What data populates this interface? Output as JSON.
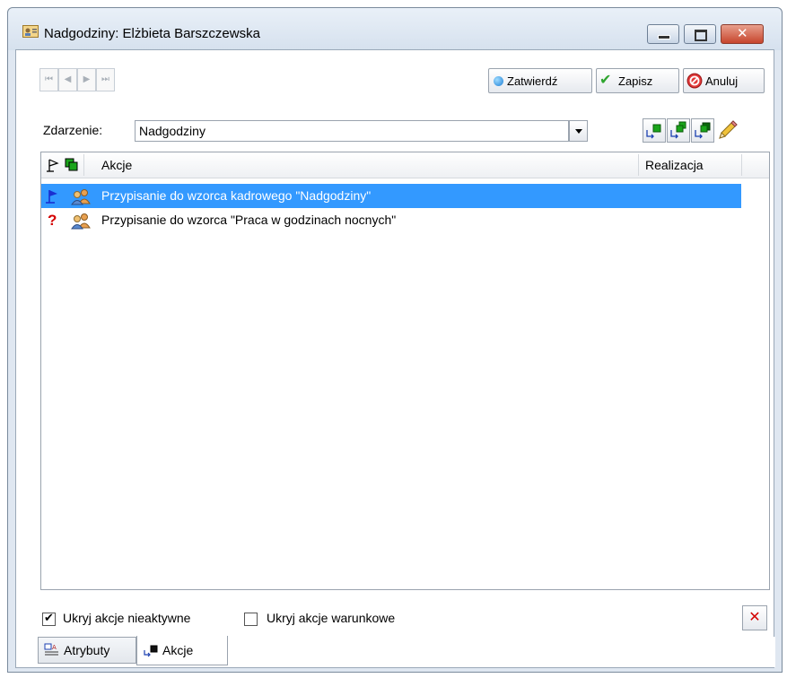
{
  "window": {
    "title": "Nadgodziny: Elżbieta Barszczewska"
  },
  "toolbar": {
    "nav_first": "⏮",
    "nav_prev": "◀",
    "nav_next": "▶",
    "nav_last": "⏭",
    "confirm_label": "Zatwierdź",
    "save_label": "Zapisz",
    "cancel_label": "Anuluj"
  },
  "event": {
    "label": "Zdarzenie:",
    "value": "Nadgodziny"
  },
  "grid": {
    "columns": [
      "Akcje",
      "Realizacja"
    ],
    "rows": [
      {
        "text": "Przypisanie do wzorca kadrowego \"Nadgodziny\"",
        "status_icon": "flag-icon",
        "selected": true
      },
      {
        "text": "Przypisanie do wzorca \"Praca w godzinach nocnych\"",
        "status_icon": "question-icon",
        "selected": false
      }
    ]
  },
  "options": {
    "hide_inactive_label": "Ukryj akcje nieaktywne",
    "hide_inactive_checked": true,
    "hide_conditional_label": "Ukryj akcje warunkowe",
    "hide_conditional_checked": false
  },
  "tabs": [
    {
      "label": "Atrybuty",
      "active": false
    },
    {
      "label": "Akcje",
      "active": true
    }
  ],
  "colors": {
    "selection": "#3399ff",
    "delete_red": "#d40000",
    "save_green": "#2fa52f",
    "confirm_blue": "#1e7fd6"
  }
}
